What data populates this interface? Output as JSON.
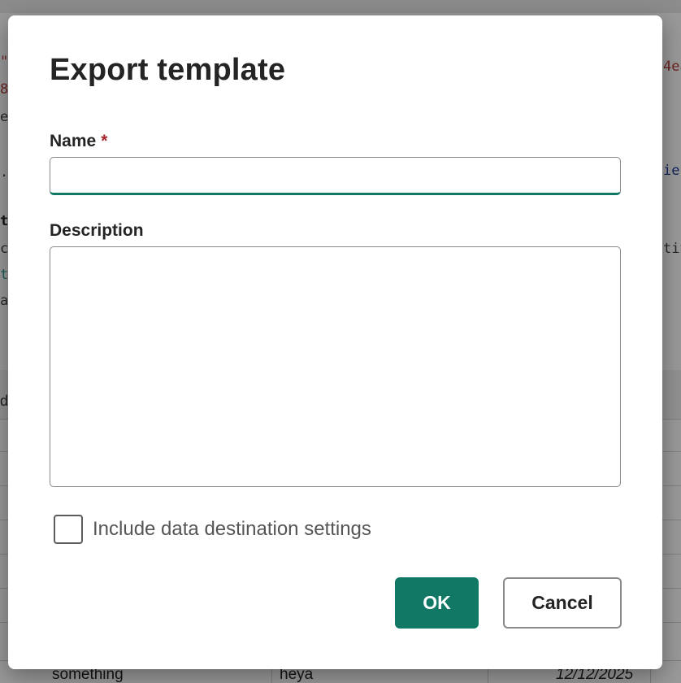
{
  "dialog": {
    "title": "Export template",
    "name_label": "Name",
    "required_marker": "*",
    "name_value": "",
    "description_label": "Description",
    "description_value": "",
    "checkbox_label": "Include data destination settings",
    "checkbox_checked": false,
    "ok_label": "OK",
    "cancel_label": "Cancel"
  },
  "background": {
    "grid_row": [
      "something",
      "heya",
      "12/12/2025"
    ]
  },
  "colors": {
    "accent": "#117865",
    "required": "#a4262c",
    "overlay": "rgba(0,0,0,0.40)"
  }
}
